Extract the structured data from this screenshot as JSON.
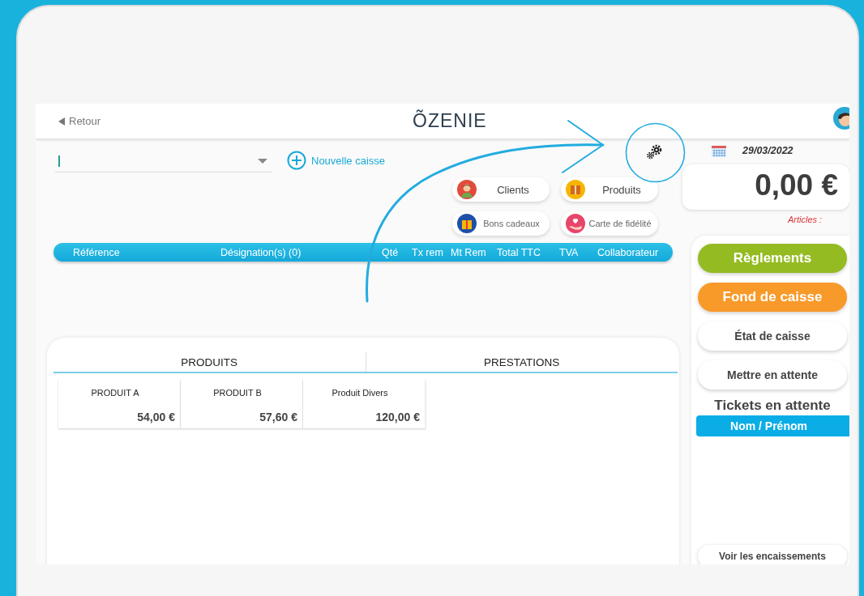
{
  "header": {
    "back": "Retour",
    "logo": "ÕZENIE"
  },
  "register": {
    "new_label": "Nouvelle caisse"
  },
  "quick_buttons": [
    {
      "label": "Clients",
      "kind": "client"
    },
    {
      "label": "Produits",
      "kind": "product"
    },
    {
      "label": "Bons cadeaux",
      "kind": "gift"
    },
    {
      "label": "Carte de fidélité",
      "kind": "loyalty"
    }
  ],
  "table": {
    "columns": [
      "Référence",
      "Désignation(s) (0)",
      "Qté",
      "Tx rem",
      "Mt Rem",
      "Total TTC",
      "TVA",
      "Collaborateur"
    ]
  },
  "catalog": {
    "tabs": [
      "PRODUITS",
      "PRESTATIONS"
    ],
    "items": [
      {
        "name": "PRODUIT A",
        "price": "54,00 €"
      },
      {
        "name": "PRODUIT B",
        "price": "57,60 €"
      },
      {
        "name": "Produit Divers",
        "price": "120,00 €"
      }
    ]
  },
  "side": {
    "date": "29/03/2022",
    "total": "0,00 €",
    "articles_label": "Articles :",
    "actions": [
      {
        "label": "Règlements",
        "kind": "green"
      },
      {
        "label": "Fond de caisse",
        "kind": "orange"
      },
      {
        "label": "État de caisse",
        "kind": "plain"
      },
      {
        "label": "Mettre en attente",
        "kind": "plain"
      }
    ],
    "tickets_title": "Tickets en attente",
    "tickets_column": "Nom / Prénom",
    "footer_button": "Voir les encaissements"
  }
}
